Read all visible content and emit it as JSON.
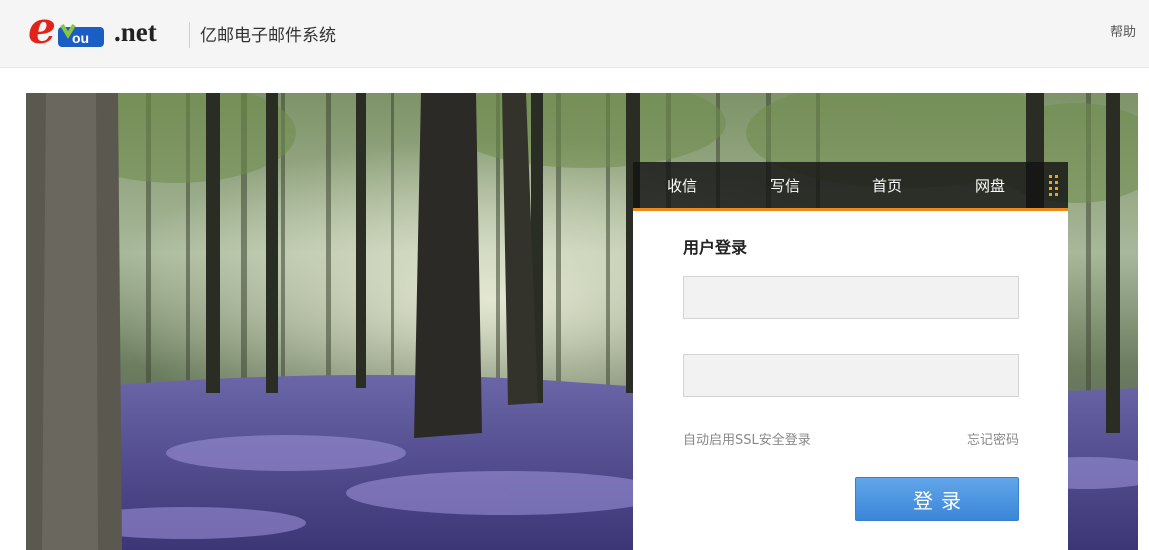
{
  "header": {
    "logo_prefix": "e",
    "logo_middle": "You",
    "logo_suffix": ".net",
    "site_title": "亿邮电子邮件系统",
    "help_label": "帮助"
  },
  "navbar": {
    "items": [
      {
        "label": "收信"
      },
      {
        "label": "写信"
      },
      {
        "label": "首页"
      },
      {
        "label": "网盘"
      }
    ],
    "menu_icon": "grid-dots-icon",
    "accent_color": "#ef8a1a"
  },
  "login": {
    "title": "用户登录",
    "username_value": "",
    "password_value": "",
    "ssl_label": "自动启用SSL安全登录",
    "forgot_label": "忘记密码",
    "submit_label": "登录",
    "button_color": "#3b86d8"
  },
  "banner": {
    "scene": "forest-with-bluebells-image"
  }
}
